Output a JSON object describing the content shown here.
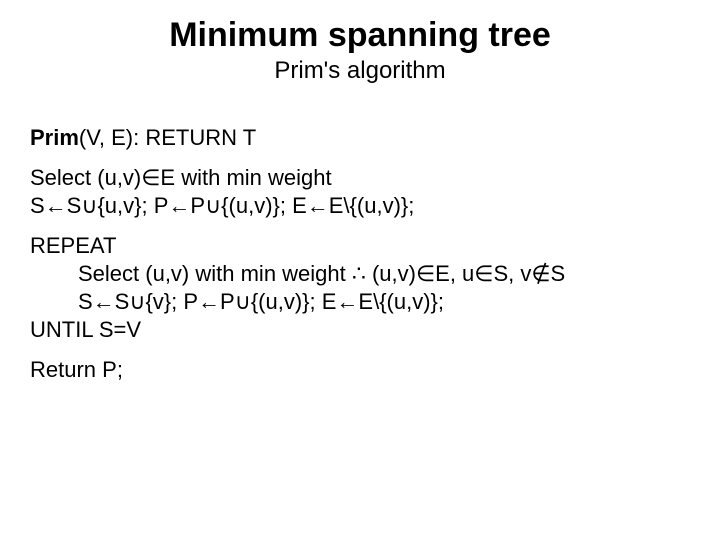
{
  "title": "Minimum spanning tree",
  "subtitle": "Prim's algorithm",
  "header": {
    "bold": "Prim",
    "rest": "(V, E): RETURN T"
  },
  "init1": "Select (u,v)∈E with min weight",
  "init2": "S←S∪{u,v}; P←P∪{(u,v)}; E←E\\{(u,v)};",
  "repeat": "REPEAT",
  "loop1": "Select (u,v) with min weight ∴ (u,v)∈E, u∈S, v∉S",
  "loop2": "S←S∪{v}; P←P∪{(u,v)}; E←E\\{(u,v)};",
  "until": "UNTIL S=V",
  "return": "Return P;"
}
